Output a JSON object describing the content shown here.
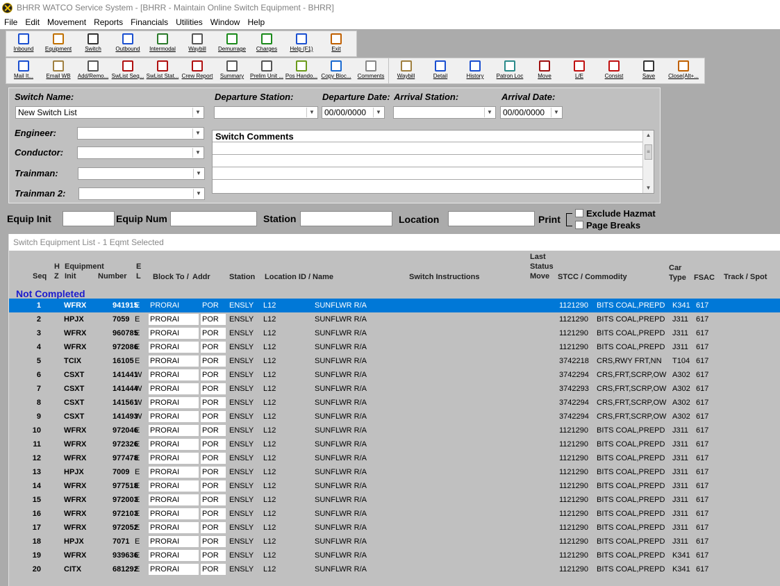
{
  "window": {
    "title": "BHRR WATCO Service System - [BHRR - Maintain Online Switch Equipment - BHRR]"
  },
  "menu": [
    "File",
    "Edit",
    "Movement",
    "Reports",
    "Financials",
    "Utilities",
    "Window",
    "Help"
  ],
  "toolbar1": [
    {
      "label": "Inbound",
      "icon": "inbound-icon",
      "color": "#1a4fd0"
    },
    {
      "label": "Equipment",
      "icon": "railcar-icon",
      "color": "#c07000"
    },
    {
      "label": "Switch",
      "icon": "track-icon",
      "color": "#333333"
    },
    {
      "label": "Outbound",
      "icon": "outbound-icon",
      "color": "#1a4fd0"
    },
    {
      "label": "Intermodal",
      "icon": "intermodal-icon",
      "color": "#2a7a2a"
    },
    {
      "label": "Waybill",
      "icon": "waybill-icon",
      "color": "#555555"
    },
    {
      "label": "Demurrage",
      "icon": "dollar-icon",
      "color": "#1a8a1a"
    },
    {
      "label": "Charges",
      "icon": "money-bag-icon",
      "color": "#1a8a1a"
    },
    {
      "label": "Help (F1)",
      "icon": "help-icon",
      "color": "#1a4fd0"
    },
    {
      "label": "Exit",
      "icon": "exit-door-icon",
      "color": "#c06000"
    }
  ],
  "toolbar2": [
    {
      "label": "Mail It...",
      "icon": "mail-icon",
      "color": "#1a4fd0"
    },
    {
      "label": "Email WB",
      "icon": "clipboard-icon",
      "color": "#a08040"
    },
    {
      "label": "Add/Remo...",
      "icon": "grid-icon",
      "color": "#555555"
    },
    {
      "label": "SwList Seq...",
      "icon": "report-icon",
      "color": "#b01010"
    },
    {
      "label": "SwList Stat...",
      "icon": "report-icon",
      "color": "#b01010"
    },
    {
      "label": "Crew Report",
      "icon": "report-icon",
      "color": "#b01010"
    },
    {
      "label": "Summary",
      "icon": "report-icon",
      "color": "#555555"
    },
    {
      "label": "Prelim Unit ...",
      "icon": "report-icon",
      "color": "#555555"
    },
    {
      "label": "Pos Hando...",
      "icon": "document-icon",
      "color": "#6a9a1a"
    },
    {
      "label": "Copy Bloc...",
      "icon": "copy-icon",
      "color": "#1a6ad0"
    },
    {
      "label": "Comments",
      "icon": "comment-icon",
      "color": "#888888"
    },
    {
      "label": "Waybill",
      "icon": "scroll-icon",
      "color": "#a08040"
    },
    {
      "label": "Detail",
      "icon": "window-icon",
      "color": "#1a4fd0"
    },
    {
      "label": "History",
      "icon": "list-icon",
      "color": "#1a4fd0"
    },
    {
      "label": "Patron Loc",
      "icon": "locate-icon",
      "color": "#2a8a8a"
    },
    {
      "label": "Move",
      "icon": "car-icon",
      "color": "#a01010"
    },
    {
      "label": "L/E",
      "icon": "pencil-icon",
      "color": "#c01010"
    },
    {
      "label": "Consist",
      "icon": "train-icon",
      "color": "#c01010"
    },
    {
      "label": "Save",
      "icon": "floppy-icon",
      "color": "#333333"
    },
    {
      "label": "Close(Alt+...",
      "icon": "close-door-icon",
      "color": "#c06000"
    }
  ],
  "form": {
    "switch_name_label": "Switch Name:",
    "switch_name_value": "New Switch List",
    "departure_station_label": "Departure Station:",
    "departure_station_value": "",
    "departure_date_label": "Departure Date:",
    "departure_date_value": "00/00/0000",
    "arrival_station_label": "Arrival Station:",
    "arrival_station_value": "",
    "arrival_date_label": "Arrival Date:",
    "arrival_date_value": "00/00/0000",
    "engineer_label": "Engineer:",
    "conductor_label": "Conductor:",
    "trainman_label": "Trainman:",
    "trainman2_label": "Trainman 2:",
    "switch_comments_label": "Switch Comments"
  },
  "filter": {
    "equip_init_label": "Equip Init",
    "equip_num_label": "Equip Num",
    "station_label": "Station",
    "location_label": "Location",
    "print_label": "Print",
    "exclude_hazmat_label": "Exclude Hazmat",
    "page_breaks_label": "Page Breaks"
  },
  "list": {
    "title": "Switch Equipment List - 1 Eqmt Selected",
    "group": "Not Completed",
    "headers": {
      "seq": "Seq",
      "h": "H",
      "z": "Z",
      "equipment": "Equipment",
      "init": "Init",
      "number": "Number",
      "e": "E",
      "l": "L",
      "block_to": "Block To /",
      "addr": "Addr",
      "station": "Station",
      "location": "Location ID / Name",
      "instructions": "Switch Instructions",
      "last": "Last",
      "status": "Status",
      "move": "Move",
      "stcc": "STCC / Commodity",
      "car": "Car",
      "type": "Type",
      "fsac": "FSAC",
      "track": "Track / Spot"
    },
    "rows": [
      {
        "seq": "1",
        "init": "WFRX",
        "num": "941915",
        "el": "E",
        "block": "PRORAI",
        "addr": "POR",
        "station": "ENSLY",
        "loc": "L12",
        "name": "SUNFLWR R/A",
        "stcc": "1121290",
        "commodity": "BITS COAL,PREPD",
        "type": "K341",
        "fsac": "617"
      },
      {
        "seq": "2",
        "init": "HPJX",
        "num": "7059",
        "el": "E",
        "block": "PRORAI",
        "addr": "POR",
        "station": "ENSLY",
        "loc": "L12",
        "name": "SUNFLWR R/A",
        "stcc": "1121290",
        "commodity": "BITS COAL,PREPD",
        "type": "J311",
        "fsac": "617"
      },
      {
        "seq": "3",
        "init": "WFRX",
        "num": "960785",
        "el": "E",
        "block": "PRORAI",
        "addr": "POR",
        "station": "ENSLY",
        "loc": "L12",
        "name": "SUNFLWR R/A",
        "stcc": "1121290",
        "commodity": "BITS COAL,PREPD",
        "type": "J311",
        "fsac": "617"
      },
      {
        "seq": "4",
        "init": "WFRX",
        "num": "972086",
        "el": "E",
        "block": "PRORAI",
        "addr": "POR",
        "station": "ENSLY",
        "loc": "L12",
        "name": "SUNFLWR R/A",
        "stcc": "1121290",
        "commodity": "BITS COAL,PREPD",
        "type": "J311",
        "fsac": "617"
      },
      {
        "seq": "5",
        "init": "TCIX",
        "num": "16105",
        "el": "E",
        "block": "PRORAI",
        "addr": "POR",
        "station": "ENSLY",
        "loc": "L12",
        "name": "SUNFLWR R/A",
        "stcc": "3742218",
        "commodity": "CRS,RWY FRT,NN",
        "type": "T104",
        "fsac": "617"
      },
      {
        "seq": "6",
        "init": "CSXT",
        "num": "141441",
        "el": "W",
        "block": "PRORAI",
        "addr": "POR",
        "station": "ENSLY",
        "loc": "L12",
        "name": "SUNFLWR R/A",
        "stcc": "3742294",
        "commodity": "CRS,FRT,SCRP,OW",
        "type": "A302",
        "fsac": "617"
      },
      {
        "seq": "7",
        "init": "CSXT",
        "num": "141444",
        "el": "W",
        "block": "PRORAI",
        "addr": "POR",
        "station": "ENSLY",
        "loc": "L12",
        "name": "SUNFLWR R/A",
        "stcc": "3742293",
        "commodity": "CRS,FRT,SCRP,OW",
        "type": "A302",
        "fsac": "617"
      },
      {
        "seq": "8",
        "init": "CSXT",
        "num": "141561",
        "el": "W",
        "block": "PRORAI",
        "addr": "POR",
        "station": "ENSLY",
        "loc": "L12",
        "name": "SUNFLWR R/A",
        "stcc": "3742294",
        "commodity": "CRS,FRT,SCRP,OW",
        "type": "A302",
        "fsac": "617"
      },
      {
        "seq": "9",
        "init": "CSXT",
        "num": "141493",
        "el": "W",
        "block": "PRORAI",
        "addr": "POR",
        "station": "ENSLY",
        "loc": "L12",
        "name": "SUNFLWR R/A",
        "stcc": "3742294",
        "commodity": "CRS,FRT,SCRP,OW",
        "type": "A302",
        "fsac": "617"
      },
      {
        "seq": "10",
        "init": "WFRX",
        "num": "972046",
        "el": "E",
        "block": "PRORAI",
        "addr": "POR",
        "station": "ENSLY",
        "loc": "L12",
        "name": "SUNFLWR R/A",
        "stcc": "1121290",
        "commodity": "BITS COAL,PREPD",
        "type": "J311",
        "fsac": "617"
      },
      {
        "seq": "11",
        "init": "WFRX",
        "num": "972326",
        "el": "E",
        "block": "PRORAI",
        "addr": "POR",
        "station": "ENSLY",
        "loc": "L12",
        "name": "SUNFLWR R/A",
        "stcc": "1121290",
        "commodity": "BITS COAL,PREPD",
        "type": "J311",
        "fsac": "617"
      },
      {
        "seq": "12",
        "init": "WFRX",
        "num": "977478",
        "el": "E",
        "block": "PRORAI",
        "addr": "POR",
        "station": "ENSLY",
        "loc": "L12",
        "name": "SUNFLWR R/A",
        "stcc": "1121290",
        "commodity": "BITS COAL,PREPD",
        "type": "J311",
        "fsac": "617"
      },
      {
        "seq": "13",
        "init": "HPJX",
        "num": "7009",
        "el": "E",
        "block": "PRORAI",
        "addr": "POR",
        "station": "ENSLY",
        "loc": "L12",
        "name": "SUNFLWR R/A",
        "stcc": "1121290",
        "commodity": "BITS COAL,PREPD",
        "type": "J311",
        "fsac": "617"
      },
      {
        "seq": "14",
        "init": "WFRX",
        "num": "977518",
        "el": "E",
        "block": "PRORAI",
        "addr": "POR",
        "station": "ENSLY",
        "loc": "L12",
        "name": "SUNFLWR R/A",
        "stcc": "1121290",
        "commodity": "BITS COAL,PREPD",
        "type": "J311",
        "fsac": "617"
      },
      {
        "seq": "15",
        "init": "WFRX",
        "num": "972003",
        "el": "E",
        "block": "PRORAI",
        "addr": "POR",
        "station": "ENSLY",
        "loc": "L12",
        "name": "SUNFLWR R/A",
        "stcc": "1121290",
        "commodity": "BITS COAL,PREPD",
        "type": "J311",
        "fsac": "617"
      },
      {
        "seq": "16",
        "init": "WFRX",
        "num": "972103",
        "el": "E",
        "block": "PRORAI",
        "addr": "POR",
        "station": "ENSLY",
        "loc": "L12",
        "name": "SUNFLWR R/A",
        "stcc": "1121290",
        "commodity": "BITS COAL,PREPD",
        "type": "J311",
        "fsac": "617"
      },
      {
        "seq": "17",
        "init": "WFRX",
        "num": "972052",
        "el": "E",
        "block": "PRORAI",
        "addr": "POR",
        "station": "ENSLY",
        "loc": "L12",
        "name": "SUNFLWR R/A",
        "stcc": "1121290",
        "commodity": "BITS COAL,PREPD",
        "type": "J311",
        "fsac": "617"
      },
      {
        "seq": "18",
        "init": "HPJX",
        "num": "7071",
        "el": "E",
        "block": "PRORAI",
        "addr": "POR",
        "station": "ENSLY",
        "loc": "L12",
        "name": "SUNFLWR R/A",
        "stcc": "1121290",
        "commodity": "BITS COAL,PREPD",
        "type": "J311",
        "fsac": "617"
      },
      {
        "seq": "19",
        "init": "WFRX",
        "num": "939636",
        "el": "E",
        "block": "PRORAI",
        "addr": "POR",
        "station": "ENSLY",
        "loc": "L12",
        "name": "SUNFLWR R/A",
        "stcc": "1121290",
        "commodity": "BITS COAL,PREPD",
        "type": "K341",
        "fsac": "617"
      },
      {
        "seq": "20",
        "init": "CITX",
        "num": "681292",
        "el": "E",
        "block": "PRORAI",
        "addr": "POR",
        "station": "ENSLY",
        "loc": "L12",
        "name": "SUNFLWR R/A",
        "stcc": "1121290",
        "commodity": "BITS COAL,PREPD",
        "type": "K341",
        "fsac": "617"
      }
    ]
  },
  "colors": {
    "selected_row": "#0078d7",
    "group_title": "#1c1ccc",
    "panel_bg": "#c0c0c0"
  }
}
